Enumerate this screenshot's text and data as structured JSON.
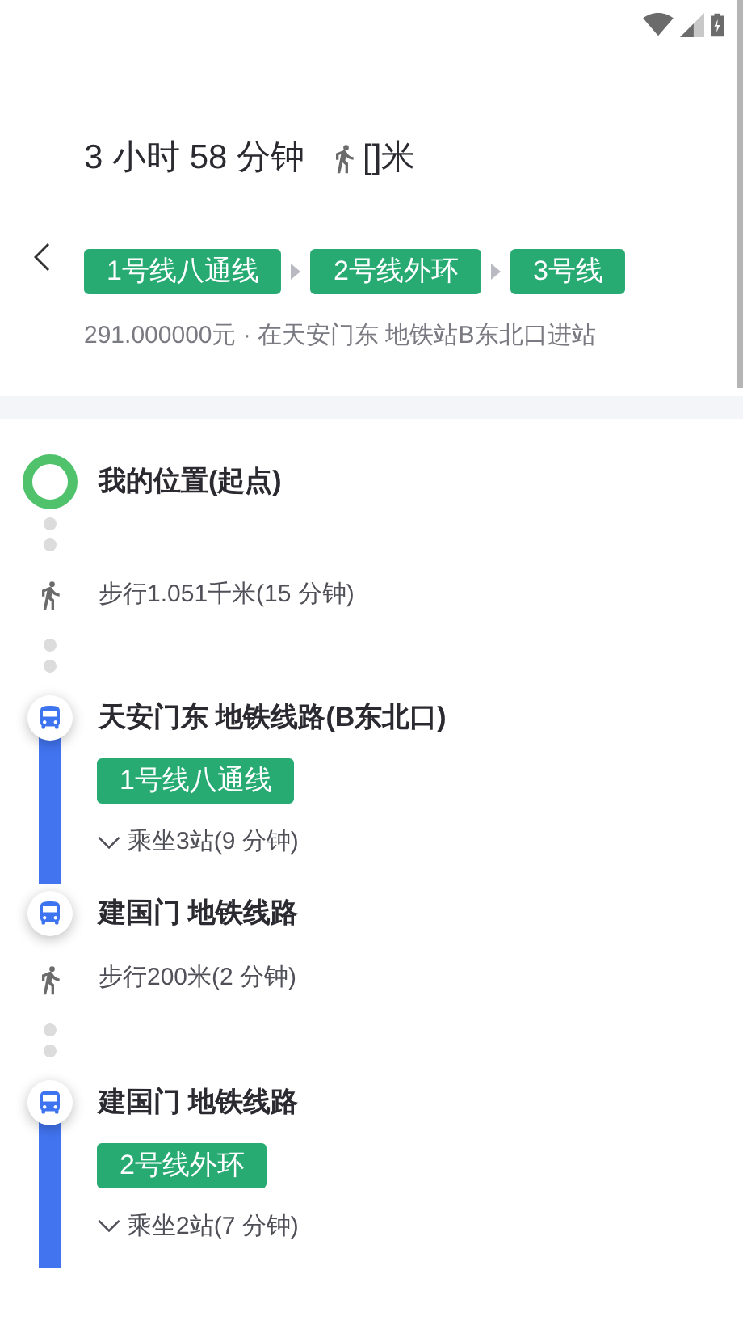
{
  "summary": {
    "duration": "3 小时 58 分钟",
    "walk_distance": "[]米"
  },
  "route_lines": [
    "1号线八通线",
    "2号线外环",
    "3号线"
  ],
  "fare_info": "291.000000元 · 在天安门东 地铁站B东北口进站",
  "steps": [
    {
      "kind": "start",
      "title": "我的位置(起点)"
    },
    {
      "kind": "walk",
      "text": "步行1.051千米(15 分钟)"
    },
    {
      "kind": "ride",
      "station": "天安门东 地铁线路(B东北口)",
      "line": "1号线八通线",
      "ride_info": "乘坐3站(9 分钟)"
    },
    {
      "kind": "stop",
      "station": "建国门 地铁线路"
    },
    {
      "kind": "walk",
      "text": "步行200米(2 分钟)"
    },
    {
      "kind": "ride",
      "station": "建国门 地铁线路",
      "line": "2号线外环",
      "ride_info": "乘坐2站(7 分钟)"
    }
  ]
}
